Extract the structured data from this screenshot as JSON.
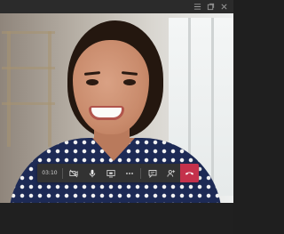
{
  "window": {
    "controls": [
      "list-icon",
      "restore-icon",
      "close-icon"
    ]
  },
  "call_toolbar": {
    "timer": "03:10",
    "buttons": [
      "video-camera-icon",
      "microphone-icon",
      "share-screen-icon",
      "more-options-icon",
      "chat-icon",
      "participants-icon"
    ],
    "hangup_color": "#c4314b"
  },
  "colors": {
    "toolbar_bg": "#323232",
    "topbar_bg": "#2b2b2b",
    "hangup": "#c4314b"
  }
}
